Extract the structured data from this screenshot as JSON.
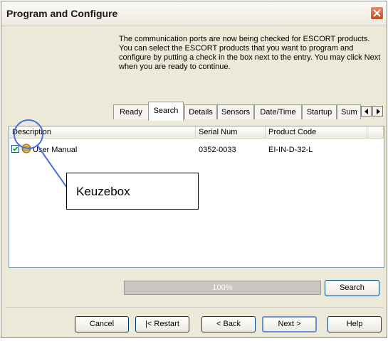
{
  "window": {
    "title": "Program and Configure"
  },
  "intro_text": "The communication ports are now being checked for ESCORT products. You can select the ESCORT products that you want to program and configure by putting a check in the box next to the entry. You may click Next when you are ready to continue.",
  "tabs": [
    {
      "label": "Ready",
      "active": false
    },
    {
      "label": "Search",
      "active": true
    },
    {
      "label": "Details",
      "active": false
    },
    {
      "label": "Sensors",
      "active": false
    },
    {
      "label": "Date/Time",
      "active": false
    },
    {
      "label": "Startup",
      "active": false
    },
    {
      "label": "Sum",
      "active": false
    }
  ],
  "list": {
    "columns": [
      "Description",
      "Serial Num",
      "Product Code"
    ],
    "rows": [
      {
        "checked": true,
        "description": "User Manual",
        "serial": "0352-0033",
        "product_code": "EI-IN-D-32-L"
      }
    ]
  },
  "annotation": {
    "label": "Keuzebox",
    "color": "#4a6fd8"
  },
  "progress": {
    "text": "100%",
    "value": 100
  },
  "buttons": {
    "search": "Search",
    "cancel": "Cancel",
    "restart": "|< Restart",
    "back": "< Back",
    "next": "Next >",
    "help": "Help"
  },
  "colors": {
    "close_button": "#c9461f",
    "list_border": "#7f9db9"
  },
  "icons": {
    "close": "close-icon",
    "tab_left": "arrow-left-icon",
    "tab_right": "arrow-right-icon",
    "item": "device-icon"
  }
}
